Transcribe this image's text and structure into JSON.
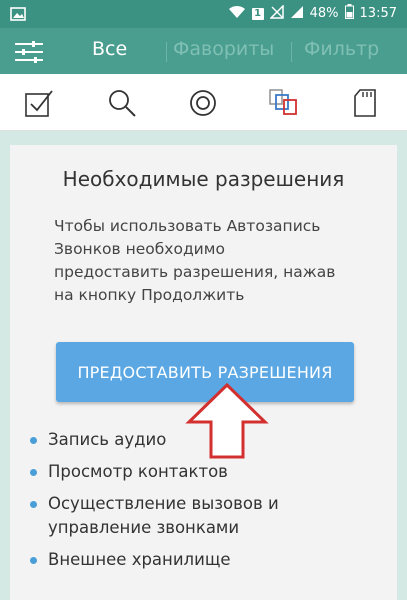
{
  "status": {
    "battery_percent": "48%",
    "time": "13:57",
    "sim_label": "1"
  },
  "appbar": {
    "tabs": [
      "Все",
      "Фавориты",
      "Фильтр"
    ]
  },
  "toolbar_icons": [
    "checkbox-icon",
    "search-icon",
    "record-icon",
    "copy-icon",
    "sd-card-icon"
  ],
  "dialog": {
    "title": "Необходимые разрешения",
    "text_lines": [
      "Чтобы использовать Автозапись",
      "Звонков необходимо",
      "предоставить разрешения, нажав",
      "на кнопку Продолжить"
    ],
    "button_label": "ПРЕДОСТАВИТЬ РАЗРЕШЕНИЯ",
    "permissions": [
      [
        "Запись аудио"
      ],
      [
        "Просмотр контактов"
      ],
      [
        "Осуществление вызовов и",
        "управление звонками"
      ],
      [
        "Внешнее хранилище"
      ]
    ]
  },
  "colors": {
    "statusbar": "#3b9283",
    "appbar": "#4a9e90",
    "button": "#5aa7e3",
    "arrow": "#d32f2f",
    "bullet": "#4a9ed8"
  }
}
